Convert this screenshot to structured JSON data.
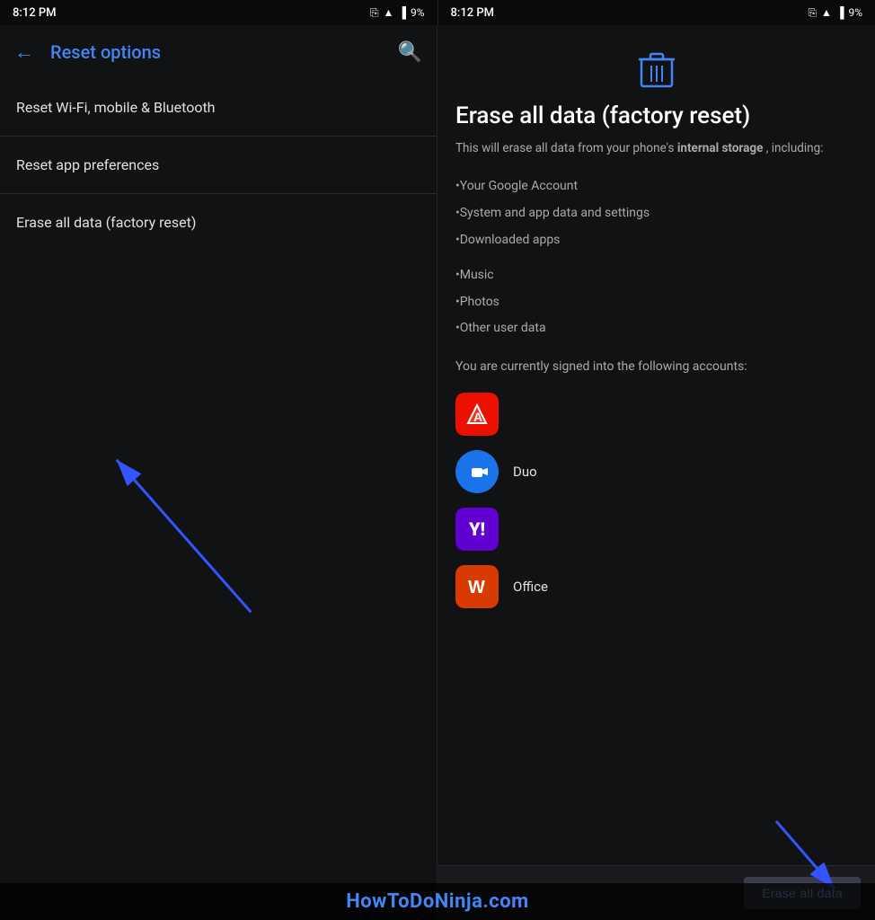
{
  "statusBar": {
    "time": "8:12 PM",
    "batteryLevel": "9%"
  },
  "leftPanel": {
    "headerTitle": "Reset options",
    "menuItems": [
      {
        "id": "wifi",
        "label": "Reset Wi-Fi, mobile & Bluetooth"
      },
      {
        "id": "app-prefs",
        "label": "Reset app preferences"
      },
      {
        "id": "factory",
        "label": "Erase all data (factory reset)"
      }
    ]
  },
  "rightPanel": {
    "pageTitle": "Erase all data (factory reset)",
    "description": "This will erase all data from your phone's",
    "descriptionBold": "internal storage",
    "descriptionSuffix": ", including:",
    "bullets1": [
      "•Your Google Account",
      "•System and app data and settings",
      "•Downloaded apps"
    ],
    "bullets2": [
      "•Music",
      "•Photos",
      "•Other user data"
    ],
    "accountsText": "You are currently signed into the following accounts:",
    "accounts": [
      {
        "id": "adobe",
        "label": ""
      },
      {
        "id": "duo",
        "label": "Duo"
      },
      {
        "id": "yahoo",
        "label": ""
      },
      {
        "id": "office",
        "label": "Office"
      }
    ],
    "eraseButtonLabel": "Erase all data"
  },
  "watermark": {
    "text": "HowToDoNinja.com"
  }
}
